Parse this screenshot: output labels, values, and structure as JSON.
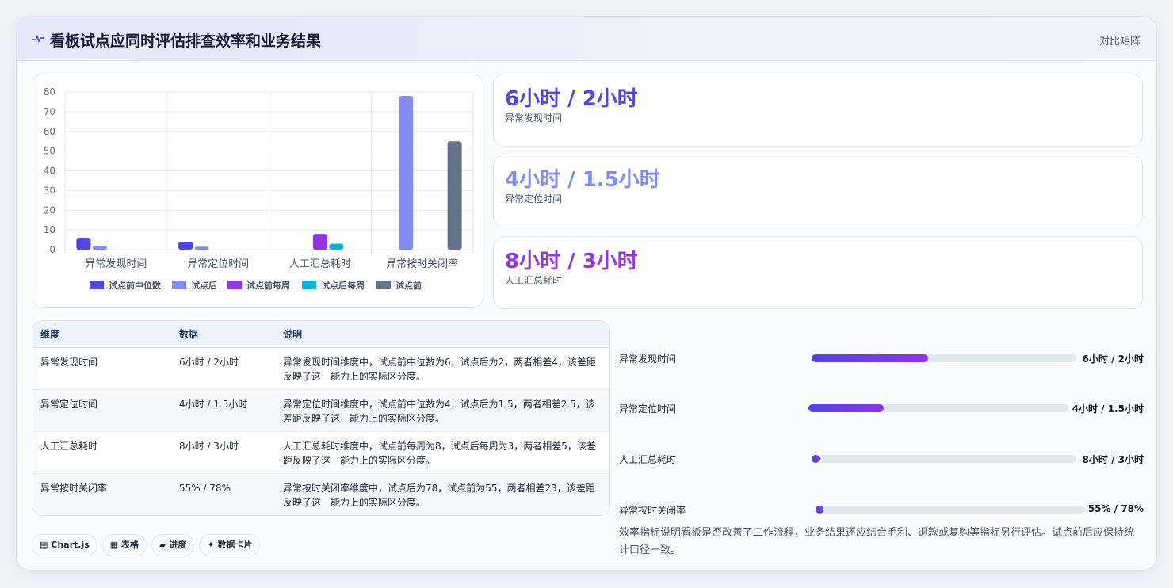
{
  "header": {
    "title": "看板试点应同时评估排查效率和业务结果",
    "right_label": "对比矩阵"
  },
  "chart_data": {
    "type": "bar",
    "categories": [
      "异常发现时间",
      "异常定位时间",
      "人工汇总耗时",
      "异常按时关闭率"
    ],
    "ylim": [
      0,
      80
    ],
    "yticks": [
      0,
      10,
      20,
      30,
      40,
      50,
      60,
      70,
      80
    ],
    "series": [
      {
        "name": "试点前中位数",
        "color": "#4f46e5",
        "values": [
          6,
          4,
          null,
          null
        ]
      },
      {
        "name": "试点后",
        "color": "#818cf8",
        "values": [
          2,
          1.5,
          null,
          78
        ]
      },
      {
        "name": "试点前每周",
        "color": "#9333ea",
        "values": [
          null,
          null,
          8,
          null
        ]
      },
      {
        "name": "试点后每周",
        "color": "#06b6d4",
        "values": [
          null,
          null,
          3,
          null
        ]
      },
      {
        "name": "试点前",
        "color": "#64748b",
        "values": [
          null,
          null,
          null,
          55
        ]
      }
    ],
    "legend_position": "bottom",
    "grid": true
  },
  "kpis": [
    {
      "value": "6小时 / 2小时",
      "label": "异常发现时间",
      "color": "#4f46e5"
    },
    {
      "value": "4小时 / 1.5小时",
      "label": "异常定位时间",
      "color": "#818cf8"
    },
    {
      "value": "8小时 / 3小时",
      "label": "人工汇总耗时",
      "color": "#9333ea"
    }
  ],
  "table": {
    "headers": [
      "维度",
      "数据",
      "说明"
    ],
    "rows": [
      [
        "异常发现时间",
        "6小时 / 2小时",
        "异常发现时间维度中，试点前中位数为6，试点后为2，两者相差4，该差距反映了这一能力上的实际区分度。"
      ],
      [
        "异常定位时间",
        "4小时 / 1.5小时",
        "异常定位时间维度中，试点前中位数为4，试点后为1.5，两者相差2.5，该差距反映了这一能力上的实际区分度。"
      ],
      [
        "人工汇总耗时",
        "8小时 / 3小时",
        "人工汇总耗时维度中，试点前每周为8，试点后每周为3，两者相差5，该差距反映了这一能力上的实际区分度。"
      ],
      [
        "异常按时关闭率",
        "55% / 78%",
        "异常按时关闭率维度中，试点后为78，试点前为55，两者相差23，该差距反映了这一能力上的实际区分度。"
      ]
    ]
  },
  "progress": [
    {
      "label": "异常发现时间",
      "value": "6小时 / 2小时",
      "fraction": 0.44
    },
    {
      "label": "异常定位时间",
      "value": "4小时 / 1.5小时",
      "fraction": 0.29
    },
    {
      "label": "人工汇总耗时",
      "value": "8小时 / 3小时",
      "fraction": 0.03
    },
    {
      "label": "异常按时关闭率",
      "value": "55% / 78%",
      "fraction": 0.03
    }
  ],
  "tags": [
    {
      "icon": "▤",
      "label": "Chart.js"
    },
    {
      "icon": "▦",
      "label": "表格"
    },
    {
      "icon": "▰",
      "label": "进度"
    },
    {
      "icon": "✦",
      "label": "数据卡片"
    }
  ],
  "note": "效率指标说明看板是否改善了工作流程，业务结果还应结合毛利、退款或复购等指标另行评估。试点前后应保持统计口径一致。"
}
